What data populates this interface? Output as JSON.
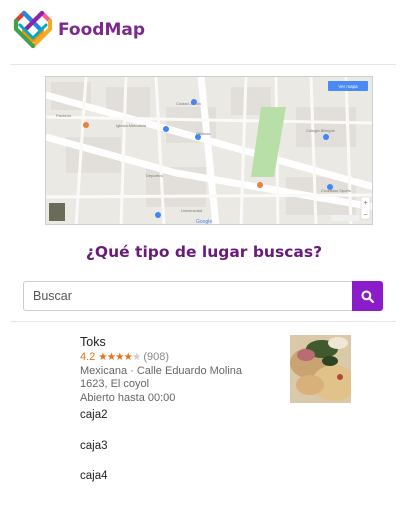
{
  "header": {
    "brand": "FoodMap",
    "logo_icon": "heart-lattice-logo-icon"
  },
  "map": {
    "alt_name": "google-map",
    "button_label": "Ver mapa"
  },
  "search": {
    "question": "¿Qué tipo de lugar buscas?",
    "placeholder": "Buscar",
    "button_icon": "search-icon",
    "accent_color": "#8b1cc9"
  },
  "result": {
    "name": "Toks",
    "rating": "4.2",
    "stars_filled": 4,
    "stars_total": 5,
    "review_count": "(908)",
    "address": "Mexicana · Calle Eduardo Molina 1623, El coyol",
    "hours": "Abierto hasta 00:00",
    "photo_icon": "food-photo"
  },
  "boxes": [
    "caja2",
    "caja3",
    "caja4"
  ]
}
